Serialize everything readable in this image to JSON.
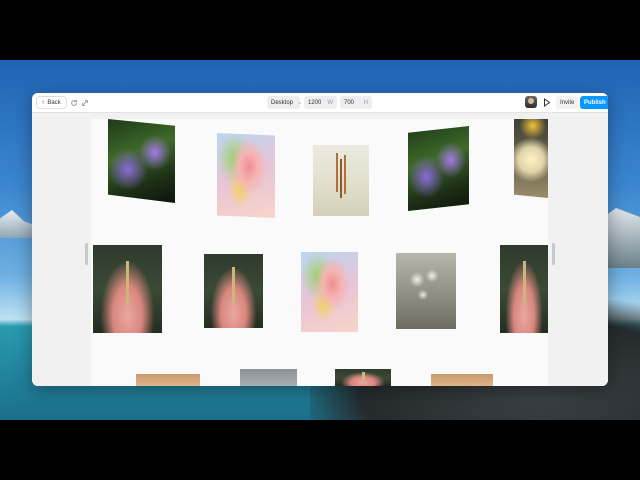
{
  "toolbar": {
    "back_label": "Back",
    "device_select": "Desktop",
    "width_value": "1200",
    "width_suffix": "W",
    "height_value": "700",
    "height_suffix": "H",
    "invite_label": "Invite",
    "publish_label": "Publish"
  },
  "colors": {
    "publish": "#0a98ff",
    "canvas_bg": "#f1f1f2",
    "frame_bg": "#fafafa"
  },
  "gallery": {
    "row1": [
      "purple-flowers",
      "pink-flower",
      "dried-sprig",
      "purple-flowers",
      "yellow-flower"
    ],
    "row2": [
      "hibiscus",
      "hibiscus",
      "pink-flower",
      "white-wildflowers",
      "hibiscus"
    ],
    "row3": [
      "warm-tile",
      "grey-tile",
      "hibiscus",
      "warm-tile"
    ]
  }
}
